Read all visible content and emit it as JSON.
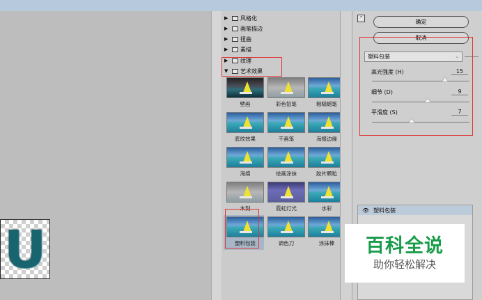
{
  "filters": {
    "categories": [
      {
        "label": "风格化",
        "expanded": false
      },
      {
        "label": "画笔描边",
        "expanded": false
      },
      {
        "label": "扭曲",
        "expanded": false
      },
      {
        "label": "素描",
        "expanded": false
      },
      {
        "label": "纹理",
        "expanded": false
      },
      {
        "label": "艺术效果",
        "expanded": true
      }
    ],
    "thumbnails": [
      "壁画",
      "彩色铅笔",
      "粗糙蜡笔",
      "底纹效果",
      "干画笔",
      "海报边缘",
      "海绵",
      "绘画涂抹",
      "胶片颗粒",
      "木刻",
      "霓虹灯光",
      "水彩",
      "塑料包装",
      "调色刀",
      "涂抹棒"
    ],
    "selected": "塑料包装"
  },
  "panel": {
    "collapse_icon": "⌃",
    "ok_label": "确定",
    "cancel_label": "取消",
    "filter_select": "塑料包装",
    "params": [
      {
        "label": "高光强度 (H)",
        "value": "15",
        "fraction": 0.75
      },
      {
        "label": "细节 (D)",
        "value": "9",
        "fraction": 0.57
      },
      {
        "label": "平滑度 (S)",
        "value": "7",
        "fraction": 0.41
      }
    ],
    "layer_name": "塑料包装"
  },
  "preview": {
    "letter": "U"
  },
  "watermark": {
    "title": "百科全说",
    "subtitle": "助你轻松解决"
  },
  "colors": {
    "accent_red": "#e03434",
    "watermark_green": "#1a9c4a",
    "selection": "#a7b7c7"
  }
}
